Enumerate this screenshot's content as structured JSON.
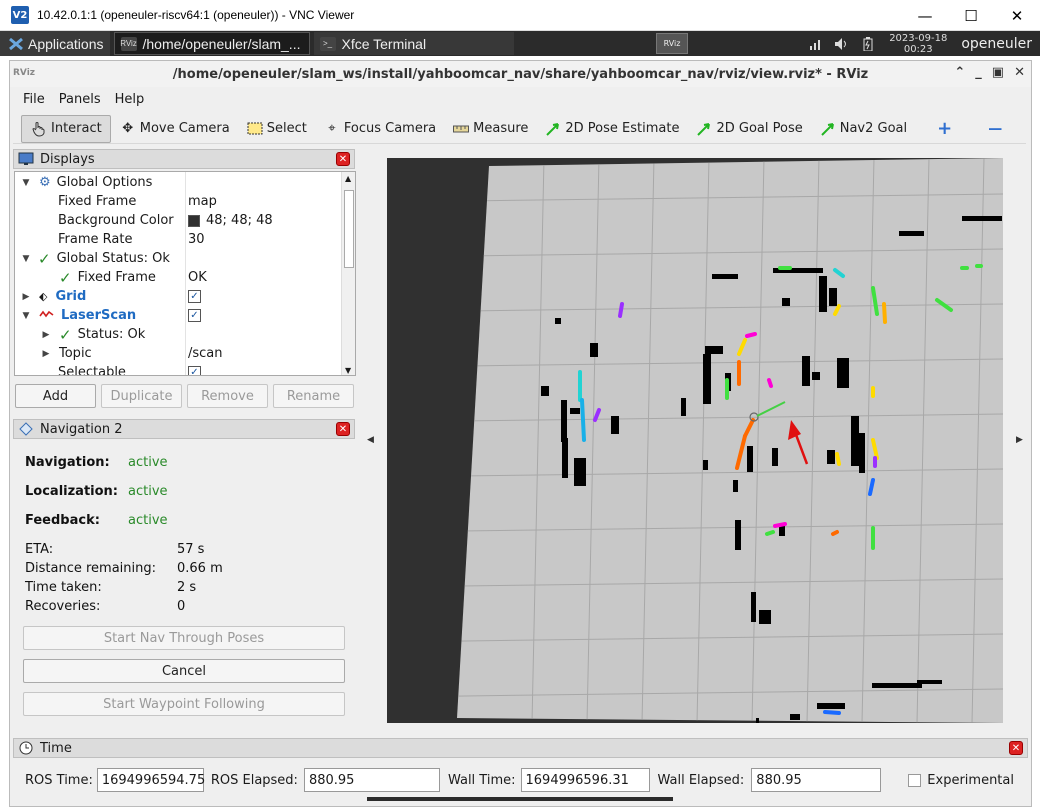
{
  "vnc": {
    "logo": "V2",
    "title": "10.42.0.1:1 (openeuler-riscv64:1 (openeuler)) - VNC Viewer",
    "minimize": "—",
    "maximize": "☐",
    "close": "✕"
  },
  "panel": {
    "applications": "Applications",
    "tasks": [
      {
        "icon": "RViz",
        "label": "/home/openeuler/slam_..."
      },
      {
        "icon": ">_",
        "label": "Xfce Terminal"
      }
    ],
    "mini_icon": "RViz",
    "clock_date": "2023-09-18",
    "clock_time": "00:23",
    "user": "openeuler"
  },
  "rviz": {
    "title": "/home/openeuler/slam_ws/install/yahboomcar_nav/share/yahboomcar_nav/rviz/view.rviz* - RViz",
    "title_icon": "RViz",
    "menu": {
      "file": "File",
      "panels": "Panels",
      "help": "Help"
    },
    "toolbar": {
      "interact": "Interact",
      "move_camera": "Move Camera",
      "select": "Select",
      "focus_camera": "Focus Camera",
      "measure": "Measure",
      "pose_estimate": "2D Pose Estimate",
      "goal_pose": "2D Goal Pose",
      "nav2_goal": "Nav2 Goal",
      "plus": "+",
      "minus": "—"
    }
  },
  "displays": {
    "title": "Displays",
    "rows": [
      {
        "label": "Global Options",
        "value": ""
      },
      {
        "label": "Fixed Frame",
        "value": "map"
      },
      {
        "label": "Background Color",
        "value": "48; 48; 48"
      },
      {
        "label": "Frame Rate",
        "value": "30"
      },
      {
        "label": "Global Status: Ok",
        "value": ""
      },
      {
        "label": "Fixed Frame",
        "value": "OK"
      },
      {
        "label": "Grid",
        "value": ""
      },
      {
        "label": "LaserScan",
        "value": ""
      },
      {
        "label": "Status: Ok",
        "value": ""
      },
      {
        "label": "Topic",
        "value": "/scan"
      },
      {
        "label": "Selectable",
        "value": ""
      }
    ],
    "buttons": {
      "add": "Add",
      "duplicate": "Duplicate",
      "remove": "Remove",
      "rename": "Rename"
    }
  },
  "navigation": {
    "title": "Navigation 2",
    "status": [
      {
        "label": "Navigation:",
        "value": "active"
      },
      {
        "label": "Localization:",
        "value": "active"
      },
      {
        "label": "Feedback:",
        "value": "active"
      }
    ],
    "metrics": [
      {
        "label": "ETA:",
        "value": "57 s"
      },
      {
        "label": "Distance remaining:",
        "value": "0.66 m"
      },
      {
        "label": "Time taken:",
        "value": "2 s"
      },
      {
        "label": "Recoveries:",
        "value": "0"
      }
    ],
    "buttons": {
      "start_nav_poses": "Start Nav Through Poses",
      "cancel": "Cancel",
      "start_waypoint": "Start Waypoint Following"
    }
  },
  "time": {
    "title": "Time",
    "ros_time_label": "ROS Time:",
    "ros_time": "1694996594.75",
    "ros_elapsed_label": "ROS Elapsed:",
    "ros_elapsed": "880.95",
    "wall_time_label": "Wall Time:",
    "wall_time": "1694996596.31",
    "wall_elapsed_label": "Wall Elapsed:",
    "wall_elapsed": "880.95",
    "experimental": "Experimental"
  },
  "colors": {
    "map_bg": "#c8c8c8",
    "grid": "#a8a8a8",
    "obstacle": "#000000",
    "goal_arrow": "#e01010",
    "status_ok": "#2a8a2a",
    "close_red": "#d22222"
  }
}
